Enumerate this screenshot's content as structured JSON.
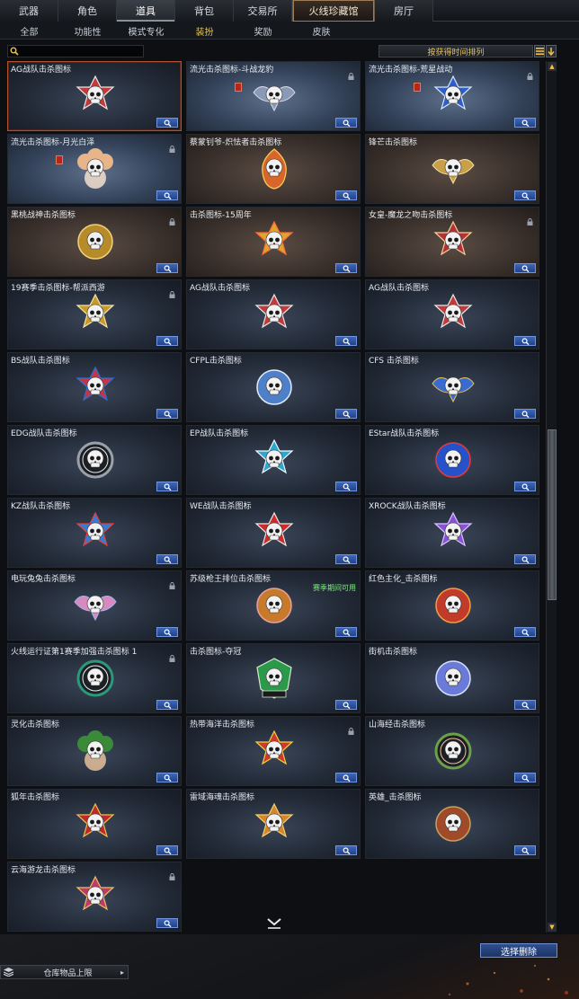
{
  "top_tabs": [
    "武器",
    "角色",
    "道具",
    "背包",
    "交易所",
    "火线珍藏馆",
    "房厅"
  ],
  "sub_tabs": [
    "全部",
    "功能性",
    "模式专化",
    "装扮",
    "奖励",
    "皮肤"
  ],
  "search": {
    "value": ""
  },
  "sort": {
    "label": "按获得时间排列"
  },
  "cards": [
    {
      "name": "AG战队击杀图标",
      "locked": false,
      "tag": false,
      "color": "#c23a3a",
      "accent": "#e8e8e8",
      "style": "star",
      "bg": "",
      "selected": true
    },
    {
      "name": "流光击杀图标-斗战龙豹",
      "locked": true,
      "tag": true,
      "color": "#8a99b6",
      "accent": "#d9dee8",
      "style": "wings",
      "bg": "rare"
    },
    {
      "name": "流光击杀图标-荒星战动",
      "locked": true,
      "tag": true,
      "color": "#2d5ec9",
      "accent": "#d8e6ff",
      "style": "star",
      "bg": "rare"
    },
    {
      "name": "流光击杀图标-月光白泽",
      "locked": true,
      "tag": true,
      "color": "#e8b48a",
      "accent": "#ffe9d4",
      "style": "flower",
      "bg": "rare"
    },
    {
      "name": "蔡蒙钊爷-炽怯者击杀图标",
      "locked": false,
      "tag": false,
      "color": "#d8662a",
      "accent": "#ffcc55",
      "style": "flame",
      "bg": "legend"
    },
    {
      "name": "锋芒击杀图标",
      "locked": false,
      "tag": false,
      "color": "#c9a04a",
      "accent": "#f5e3a8",
      "style": "wings",
      "bg": "legend"
    },
    {
      "name": "黑桃战神击杀图标",
      "locked": true,
      "tag": false,
      "color": "#b78a2a",
      "accent": "#f2d27a",
      "style": "round",
      "bg": "legend"
    },
    {
      "name": "击杀图标-15周年",
      "locked": false,
      "tag": false,
      "color": "#e0a32b",
      "accent": "#ff6a3a",
      "style": "star",
      "bg": "legend"
    },
    {
      "name": "女皇-魔龙之吻击杀图标",
      "locked": true,
      "tag": false,
      "color": "#b5303a",
      "accent": "#f0d090",
      "style": "star",
      "bg": "legend"
    },
    {
      "name": "19赛季击杀图标-帮派西游",
      "locked": true,
      "tag": false,
      "color": "#c99a2a",
      "accent": "#f3e3a8",
      "style": "star",
      "bg": ""
    },
    {
      "name": "AG战队击杀图标",
      "locked": false,
      "tag": false,
      "color": "#c23a3a",
      "accent": "#e8e8e8",
      "style": "star",
      "bg": ""
    },
    {
      "name": "AG战队击杀图标",
      "locked": false,
      "tag": false,
      "color": "#c23a3a",
      "accent": "#e8e8e8",
      "style": "star",
      "bg": ""
    },
    {
      "name": "BS战队击杀图标",
      "locked": false,
      "tag": false,
      "color": "#c2354a",
      "accent": "#2b6fd4",
      "style": "star",
      "bg": ""
    },
    {
      "name": "CFPL击杀图标",
      "locked": false,
      "tag": false,
      "color": "#4e7fc9",
      "accent": "#e2ecf8",
      "style": "round",
      "bg": ""
    },
    {
      "name": "CFS 击杀图标",
      "locked": false,
      "tag": false,
      "color": "#3a6bd0",
      "accent": "#e8c45a",
      "style": "wings",
      "bg": ""
    },
    {
      "name": "EDG战队击杀图标",
      "locked": false,
      "tag": false,
      "color": "#9aa1aa",
      "accent": "#e6e8ea",
      "style": "ring",
      "bg": ""
    },
    {
      "name": "EP战队击杀图标",
      "locked": false,
      "tag": false,
      "color": "#2aa8d0",
      "accent": "#f2f8ff",
      "style": "star",
      "bg": ""
    },
    {
      "name": "EStar战队击杀图标",
      "locked": false,
      "tag": false,
      "color": "#2552c9",
      "accent": "#e83a3a",
      "style": "round",
      "bg": ""
    },
    {
      "name": "KZ战队击杀图标",
      "locked": false,
      "tag": false,
      "color": "#3a7ad0",
      "accent": "#e04040",
      "style": "star",
      "bg": ""
    },
    {
      "name": "WE战队击杀图标",
      "locked": false,
      "tag": false,
      "color": "#d02a2a",
      "accent": "#e8e8e8",
      "style": "star",
      "bg": ""
    },
    {
      "name": "XROCK战队击杀图标",
      "locked": false,
      "tag": false,
      "color": "#8a52d8",
      "accent": "#d8c4ff",
      "style": "star",
      "bg": ""
    },
    {
      "name": "电玩兔兔击杀图标",
      "locked": true,
      "tag": false,
      "color": "#d88ac0",
      "accent": "#9ab8f0",
      "style": "wings",
      "bg": ""
    },
    {
      "name": "苏级枪王排位击杀图标",
      "locked": false,
      "tag": false,
      "color": "#c77a2a",
      "accent": "#e8a0a0",
      "style": "round",
      "bg": "",
      "note": "赛季期间可用"
    },
    {
      "name": "红色主化_击杀图标",
      "locked": false,
      "tag": false,
      "color": "#c23a2a",
      "accent": "#f0a040",
      "style": "round",
      "bg": ""
    },
    {
      "name": "火线运行证第1赛季加强击杀图标 1",
      "locked": true,
      "tag": false,
      "color": "#2a9a7a",
      "accent": "#e8f0f0",
      "style": "ring",
      "bg": ""
    },
    {
      "name": "击杀图标-夺冠",
      "locked": false,
      "tag": false,
      "color": "#2a9a4a",
      "accent": "#d8e8d0",
      "style": "shield",
      "bg": ""
    },
    {
      "name": "街机击杀图标",
      "locked": false,
      "tag": false,
      "color": "#6a7ad8",
      "accent": "#d8e0ff",
      "style": "round",
      "bg": ""
    },
    {
      "name": "灵化击杀图标",
      "locked": false,
      "tag": false,
      "color": "#3a8a3a",
      "accent": "#f0c8a0",
      "style": "flower",
      "bg": ""
    },
    {
      "name": "热带海洋击杀图标",
      "locked": true,
      "tag": false,
      "color": "#d03a2a",
      "accent": "#f0d040",
      "style": "star",
      "bg": ""
    },
    {
      "name": "山海经击杀图标",
      "locked": false,
      "tag": false,
      "color": "#6aa04a",
      "accent": "#f0c0a0",
      "style": "ring",
      "bg": ""
    },
    {
      "name": "狐年击杀图标",
      "locked": false,
      "tag": false,
      "color": "#c02a2a",
      "accent": "#e8c04a",
      "style": "star",
      "bg": ""
    },
    {
      "name": "雷域海魂击杀图标",
      "locked": false,
      "tag": false,
      "color": "#d8852a",
      "accent": "#f0d070",
      "style": "star",
      "bg": ""
    },
    {
      "name": "英雄_击杀图标",
      "locked": false,
      "tag": false,
      "color": "#a04a2a",
      "accent": "#c8a060",
      "style": "round",
      "bg": ""
    },
    {
      "name": "云海游龙击杀图标",
      "locked": true,
      "tag": false,
      "color": "#c03a6a",
      "accent": "#e8c060",
      "style": "star",
      "bg": ""
    }
  ],
  "delete_button": "选择删除",
  "storage_label": "仓库物品上限"
}
